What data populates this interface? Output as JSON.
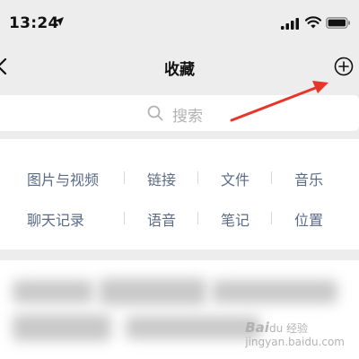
{
  "status_bar": {
    "time": "13:24"
  },
  "nav": {
    "title": "收藏",
    "back_icon": "chevron-left-icon",
    "add_icon": "plus-circle-icon"
  },
  "search": {
    "placeholder": "搜索",
    "icon": "search-icon"
  },
  "categories": {
    "row1": [
      "图片与视频",
      "链接",
      "文件",
      "音乐"
    ],
    "row2": [
      "聊天记录",
      "语音",
      "笔记",
      "位置"
    ]
  },
  "colors": {
    "background": "#ededed",
    "category_text": "#5b6b88",
    "annotation": "#e8342a"
  },
  "watermark": {
    "brand": "Bai",
    "suffix": "du 经验",
    "sub": "jingyan.baidu.com"
  }
}
